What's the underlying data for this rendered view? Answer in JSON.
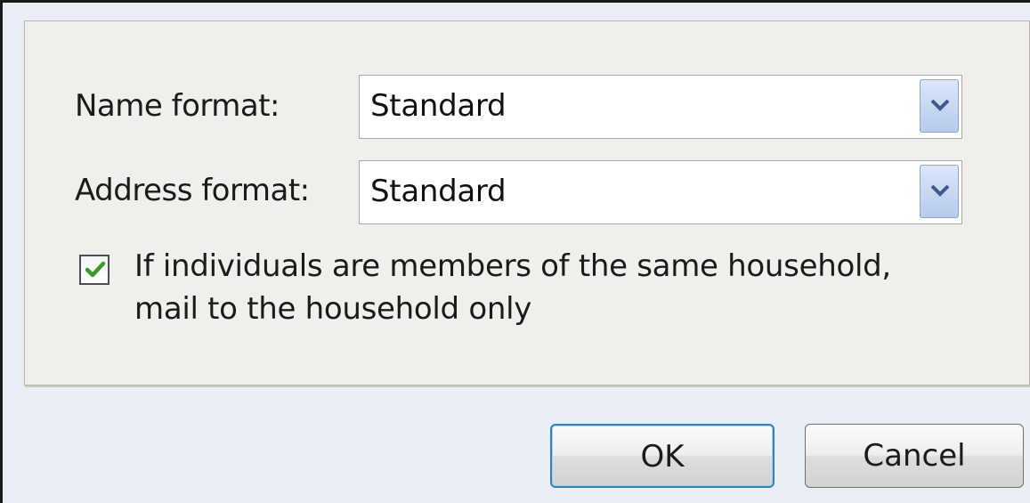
{
  "form": {
    "name_format": {
      "label": "Name format:",
      "value": "Standard"
    },
    "address_format": {
      "label": "Address format:",
      "value": "Standard"
    },
    "household": {
      "checked": true,
      "label": "If individuals are members of the same household, mail to the household only"
    }
  },
  "buttons": {
    "ok_label": "OK",
    "cancel_label": "Cancel"
  },
  "colors": {
    "dialog_background": "#e9eef6",
    "panel_background": "#f0efeb",
    "check_green": "#3a9a2a",
    "default_button_border": "#3c7fb1"
  },
  "icons": {
    "dropdown": "chevron-down-icon",
    "check": "checkmark-icon"
  }
}
